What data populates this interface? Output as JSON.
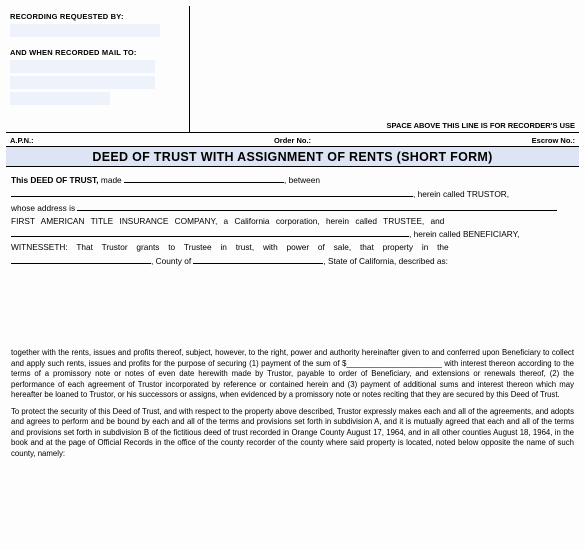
{
  "header": {
    "recording_requested_by": "RECORDING REQUESTED BY:",
    "when_recorded_mail_to": "AND WHEN RECORDED MAIL TO:",
    "space_above_note": "SPACE ABOVE THIS LINE IS FOR RECORDER'S USE"
  },
  "info_row": {
    "apn_label": "A.P.N.:",
    "order_label": "Order No.:",
    "escrow_label": "Escrow No.:"
  },
  "title": "DEED OF TRUST WITH ASSIGNMENT OF RENTS (SHORT FORM)",
  "body": {
    "line1_a": "This ",
    "line1_b": "DEED OF TRUST,",
    "line1_c": " made ",
    "line1_d": ", between",
    "line2_tail": ", herein called TRUSTOR,",
    "line3_a": "whose address is ",
    "line4": "FIRST AMERICAN TITLE INSURANCE COMPANY, a California corporation, herein called TRUSTEE, and",
    "line5_tail": ", herein called BENEFICIARY,",
    "line6": "WITNESSETH: That Trustor grants to Trustee in trust, with power of sale, that property in the",
    "line7_mid": ", County of ",
    "line7_tail": ", State of California, described as:"
  },
  "para1": "together with the rents, issues and profits thereof, subject, however, to the right, power and authority hereinafter given to and conferred upon Beneficiary to collect and apply such rents, issues and profits for the purpose of securing (1) payment of the sum of $______________________ with interest thereon according to the terms of a promissory note or notes of even date herewith made by Trustor, payable to order of Beneficiary, and extensions or renewals thereof, (2) the performance of each agreement of Trustor incorporated by reference or contained herein and (3) payment of additional sums and interest thereon which may hereafter be loaned to Trustor, or his successors or assigns, when evidenced by a promissory note or notes reciting that they are secured by this Deed of Trust.",
  "para2": "To protect the security of this Deed of Trust, and with respect to the property above described, Trustor expressly makes each and all of the agreements, and adopts and agrees to perform and be bound by each and all of the terms and provisions set forth in subdivision A, and it is mutually agreed that each and all of the terms and provisions set forth in subdivision B of the fictitious deed of trust recorded in Orange County August 17, 1964, and in all other counties August 18, 1964, in the book and at the page of Official Records in the office of the county recorder of the county where said property is located, noted below opposite the name of such county, namely:"
}
